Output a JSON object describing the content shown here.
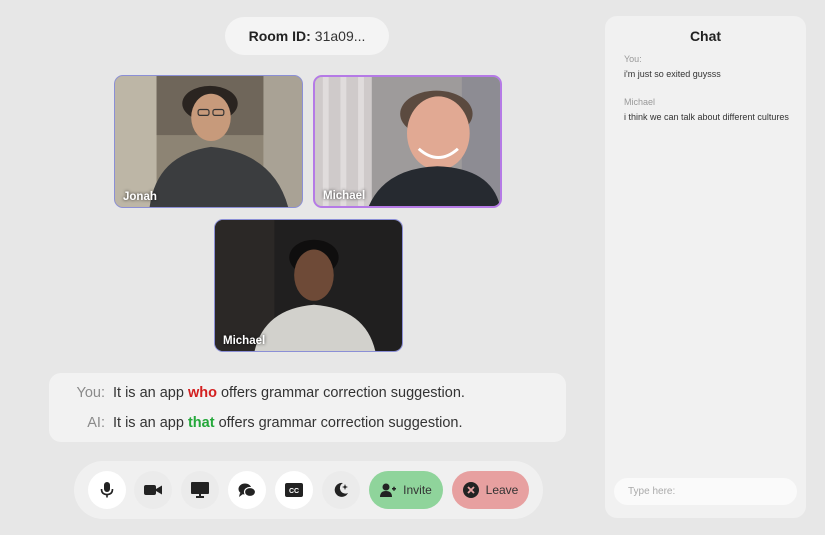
{
  "room": {
    "label": "Room ID:",
    "id": "31a09..."
  },
  "participants": [
    {
      "name": "Jonah"
    },
    {
      "name": "Michael"
    },
    {
      "name": "Michael"
    }
  ],
  "captions": {
    "user": {
      "speaker": "You:",
      "before": "It is an app ",
      "highlight": "who",
      "after": " offers grammar correction suggestion.",
      "highlight_color": "#d31f1f"
    },
    "ai": {
      "speaker": "AI:",
      "before": "It is an app ",
      "highlight": "that",
      "after": " offers grammar correction suggestion.",
      "highlight_color": "#24a83a"
    }
  },
  "controls": {
    "buttons": [
      "microphone-icon",
      "camera-icon",
      "screen-share-icon",
      "chat-bubbles-icon",
      "closed-captions-icon",
      "ai-assist-icon"
    ],
    "invite_label": "Invite",
    "leave_label": "Leave",
    "invite_color": "#8fd49b",
    "leave_color": "#e7a0a0"
  },
  "chat": {
    "title": "Chat",
    "messages": [
      {
        "from": "You:",
        "text": "i'm just so exited guysss"
      },
      {
        "from": "Michael",
        "text": "i think we can talk about different cultures"
      }
    ],
    "input_placeholder": "Type here:"
  }
}
